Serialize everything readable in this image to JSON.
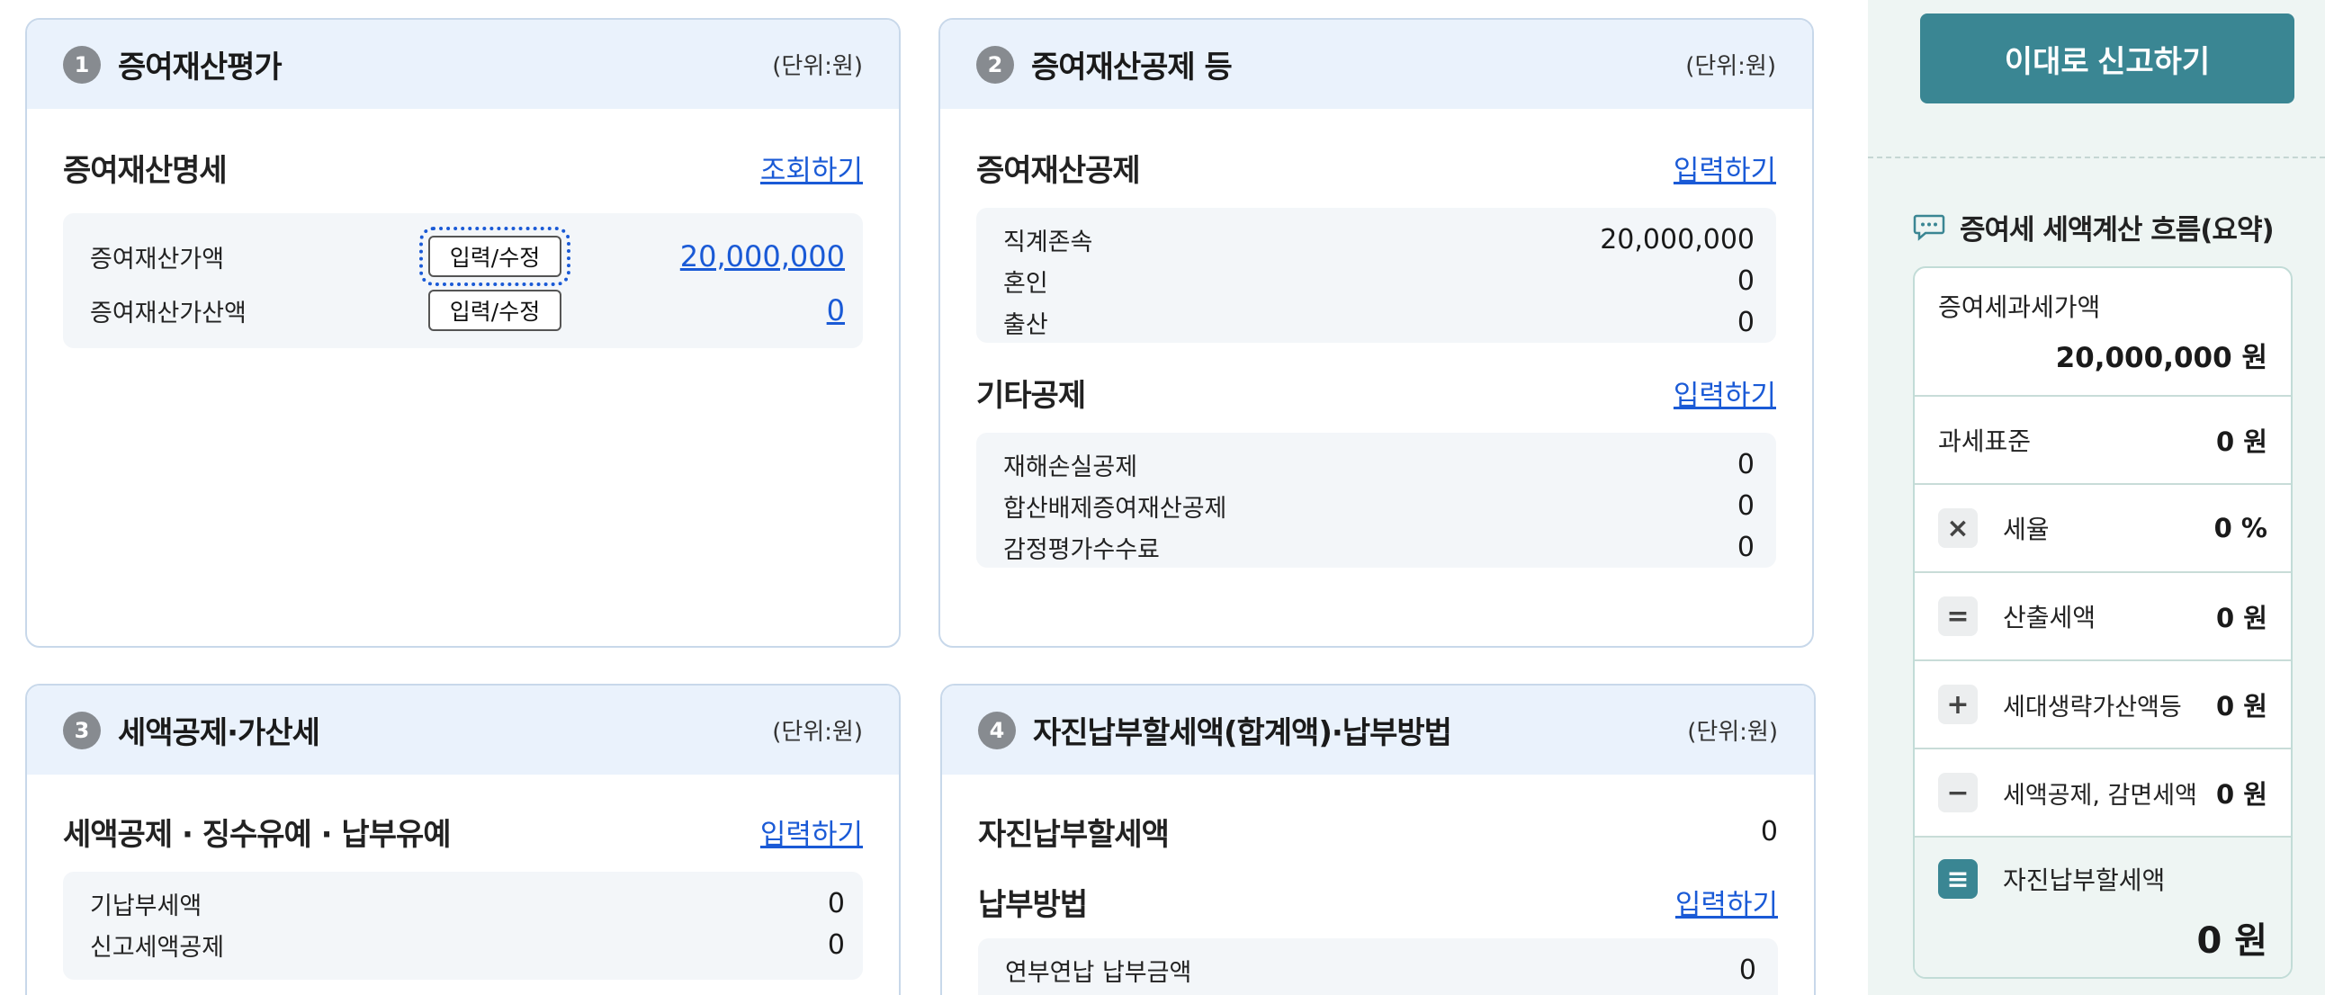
{
  "card1": {
    "num": "1",
    "title": "증여재산평가",
    "unit": "(단위:원)",
    "section": {
      "title": "증여재산명세",
      "link": "조회하기"
    },
    "rows": [
      {
        "label": "증여재산가액",
        "button": "입력/수정",
        "value": "20,000,000"
      },
      {
        "label": "증여재산가산액",
        "button": "입력/수정",
        "value": "0"
      }
    ]
  },
  "card2": {
    "num": "2",
    "title": "증여재산공제 등",
    "unit": "(단위:원)",
    "section1": {
      "title": "증여재산공제",
      "link": "입력하기",
      "rows": [
        {
          "label": "직계존속",
          "value": "20,000,000"
        },
        {
          "label": "혼인",
          "value": "0"
        },
        {
          "label": "출산",
          "value": "0"
        }
      ]
    },
    "section2": {
      "title": "기타공제",
      "link": "입력하기",
      "rows": [
        {
          "label": "재해손실공제",
          "value": "0"
        },
        {
          "label": "합산배제증여재산공제",
          "value": "0"
        },
        {
          "label": "감정평가수수료",
          "value": "0"
        }
      ]
    }
  },
  "card3": {
    "num": "3",
    "title": "세액공제·가산세",
    "unit": "(단위:원)",
    "section": {
      "title": "세액공제 · 징수유예 · 납부유예",
      "link": "입력하기"
    },
    "rows": [
      {
        "label": "기납부세액",
        "value": "0"
      },
      {
        "label": "신고세액공제",
        "value": "0"
      }
    ]
  },
  "card4": {
    "num": "4",
    "title": "자진납부할세액(합계액)·납부방법",
    "unit": "(단위:원)",
    "self_pay": {
      "title": "자진납부할세액",
      "value": "0"
    },
    "method": {
      "title": "납부방법",
      "link": "입력하기"
    },
    "rows": [
      {
        "label": "연부연납 납부금액",
        "value": "0"
      }
    ]
  },
  "side": {
    "submit_label": "이대로 신고하기",
    "flow_title": "증여세 세액계산 흐름(요약)",
    "taxable_label": "증여세과세가액",
    "taxable_value": "20,000,000 원",
    "base_label": "과세표준",
    "base_value": "0 원",
    "rate_op": "×",
    "rate_label": "세율",
    "rate_value": "0 %",
    "calc_op": "=",
    "calc_label": "산출세액",
    "calc_value": "0 원",
    "gen_op": "+",
    "gen_label": "세대생략가산액등",
    "gen_value": "0 원",
    "ded_op": "−",
    "ded_label": "세액공제, 감면세액",
    "ded_value": "0 원",
    "final_op": "≡",
    "final_label": "자진납부할세액",
    "final_value": "0 원"
  }
}
